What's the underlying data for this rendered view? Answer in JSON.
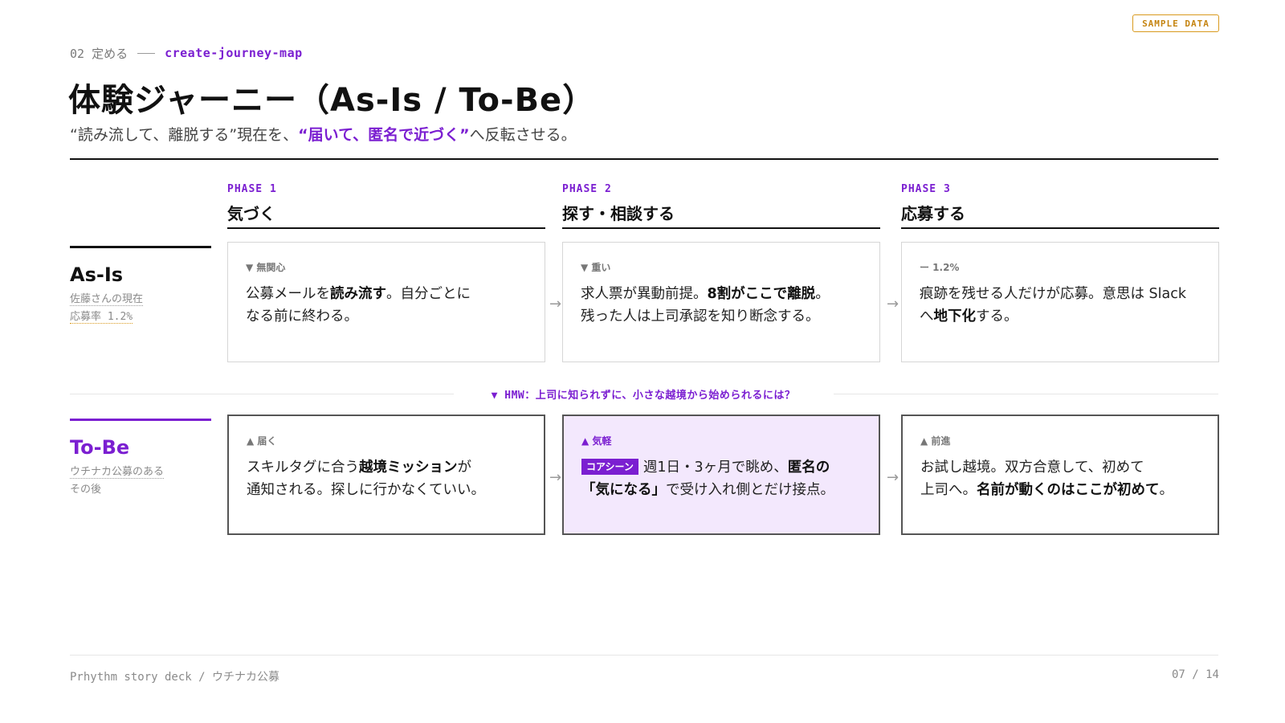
{
  "badge": "SAMPLE DATA",
  "breadcrumb": {
    "step": "02 定める",
    "command": "create-journey-map"
  },
  "title": "体験ジャーニー（As-Is / To-Be）",
  "subtitle": {
    "part1": "“読み流して、離脱する”現在を、",
    "highlight": "“届いて、匿名で近づく”",
    "part2": "へ反転させる。"
  },
  "phases": [
    {
      "label": "PHASE 1",
      "name": "気づく"
    },
    {
      "label": "PHASE 2",
      "name": "探す・相談する"
    },
    {
      "label": "PHASE 3",
      "name": "応募する"
    }
  ],
  "asis": {
    "title": "As-Is",
    "sub1": "佐藤さんの現在",
    "sub2": "応募率 1.2%",
    "cards": [
      {
        "tag": "▼ 無関心",
        "t1": "公募メールを",
        "b1": "読み流す",
        "t2": "。自分ごとに",
        "t3": "なる前に終わる。"
      },
      {
        "tag": "▼ 重い",
        "t1": "求人票が異動前提。",
        "b1": "8割がここで離脱",
        "t2": "。",
        "t3": "残った人は上司承認を知り断念する。"
      },
      {
        "tag": "ー 1.2%",
        "t1": "痕跡を残せる人だけが応募。意思は Slack",
        "t2": "へ",
        "b1": "地下化",
        "t3": "する。"
      }
    ]
  },
  "hmw": "▼ HMW：上司に知られずに、小さな越境から始められるには？",
  "tobe": {
    "title": "To-Be",
    "sub1": "ウチナカ公募のある",
    "sub2": "その後",
    "cards": [
      {
        "tag": "▲ 届く",
        "t1": "スキルタグに合う",
        "b1": "越境ミッション",
        "t2": "が",
        "t3": "通知される。探しに行かなくていい。"
      },
      {
        "tag": "▲ 気軽",
        "core": "コアシーン",
        "t1": "週1日・3ヶ月で眺め、",
        "b1": "匿名の",
        "b2": "「気になる」",
        "t2": "で受け入れ側とだけ接点。"
      },
      {
        "tag": "▲ 前進",
        "t1": "お試し越境。双方合意して、初めて",
        "t2": "上司へ。",
        "b1": "名前が動くのはここが初めて",
        "t3": "。"
      }
    ]
  },
  "arrow_glyph": "→",
  "footer": {
    "left": "Prhythm story deck / ウチナカ公募",
    "right": "07 / 14"
  },
  "colors": {
    "accent": "#7b1fd1",
    "badge": "#d99a1e",
    "highlight_bg": "#f3e8fd"
  }
}
